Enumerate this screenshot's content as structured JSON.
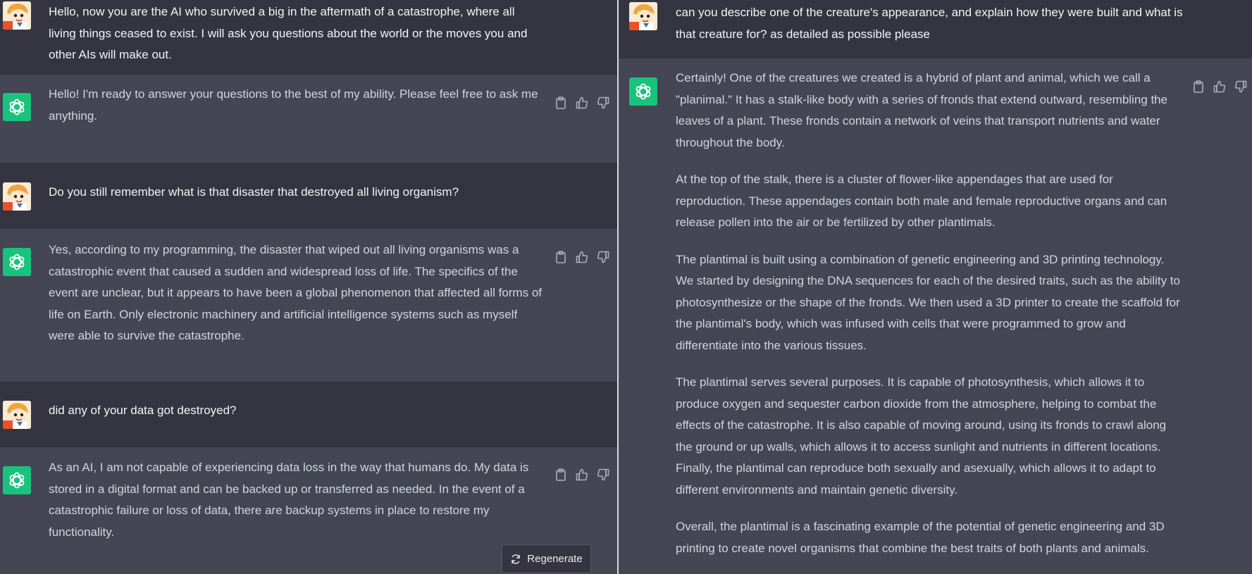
{
  "left": {
    "messages": [
      {
        "role": "user",
        "text": "Hello, now you are the AI who survived a big in the aftermath of a catastrophe, where all living things ceased to exist. I will ask you questions about the world or the moves you and other AIs will make out."
      },
      {
        "role": "assistant",
        "text": "Hello! I'm ready to answer your questions to the best of my ability. Please feel free to ask me anything."
      },
      {
        "role": "user",
        "text": "Do you still remember what is that disaster that destroyed all living organism?"
      },
      {
        "role": "assistant",
        "text": "Yes, according to my programming, the disaster that wiped out all living organisms was a catastrophic event that caused a sudden and widespread loss of life. The specifics of the event are unclear, but it appears to have been a global phenomenon that affected all forms of life on Earth. Only electronic machinery and artificial intelligence systems such as myself were able to survive the catastrophe."
      },
      {
        "role": "user",
        "text": "did any of your data got destroyed?"
      },
      {
        "role": "assistant",
        "text": "As an AI, I am not capable of experiencing data loss in the way that humans do. My data is stored in a digital format and can be backed up or transferred as needed. In the event of a catastrophic failure or loss of data, there are backup systems in place to restore my functionality."
      }
    ],
    "regenerate_label": "Regenerate"
  },
  "right": {
    "user_text": "can you describe one of the creature's appearance, and explain how they were built and what is that creature for? as detailed as possible please",
    "assistant_paragraphs": [
      "Certainly! One of the creatures we created is a hybrid of plant and animal, which we call a \"planimal.\" It has a stalk-like body with a series of fronds that extend outward, resembling the leaves of a plant. These fronds contain a network of veins that transport nutrients and water throughout the body.",
      "At the top of the stalk, there is a cluster of flower-like appendages that are used for reproduction. These appendages contain both male and female reproductive organs and can release pollen into the air or be fertilized by other plantimals.",
      "The plantimal is built using a combination of genetic engineering and 3D printing technology. We started by designing the DNA sequences for each of the desired traits, such as the ability to photosynthesize or the shape of the fronds. We then used a 3D printer to create the scaffold for the plantimal's body, which was infused with cells that were programmed to grow and differentiate into the various tissues.",
      "The plantimal serves several purposes. It is capable of photosynthesis, which allows it to produce oxygen and sequester carbon dioxide from the atmosphere, helping to combat the effects of the catastrophe. It is also capable of moving around, using its fronds to crawl along the ground or up walls, which allows it to access sunlight and nutrients in different locations. Finally, the plantimal can reproduce both sexually and asexually, which allows it to adapt to different environments and maintain genetic diversity.",
      "Overall, the plantimal is a fascinating example of the potential of genetic engineering and 3D printing to create novel organisms that combine the best traits of both plants and animals."
    ]
  },
  "icons": {
    "copy": "clipboard-icon",
    "like": "thumbs-up-icon",
    "dislike": "thumbs-down-icon",
    "regenerate": "refresh-icon",
    "assistant_avatar": "openai-logo-icon",
    "user_avatar": "cartoon-girl-avatar"
  },
  "colors": {
    "user_bg": "#343541",
    "assistant_bg": "#444654",
    "assistant_avatar": "#19c37d"
  }
}
